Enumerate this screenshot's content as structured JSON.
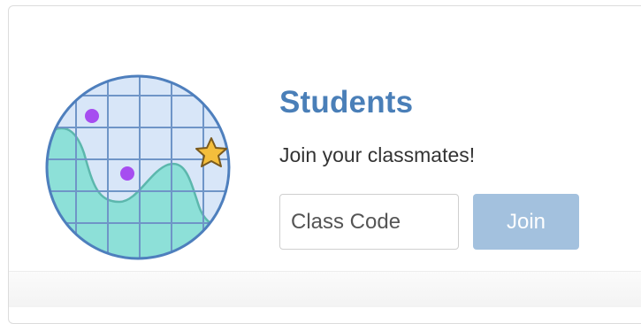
{
  "card": {
    "title": "Students",
    "subtitle": "Join your classmates!",
    "class_code": {
      "value": "",
      "placeholder": "Class Code"
    },
    "join_label": "Join"
  },
  "colors": {
    "title": "#4a7fb8",
    "join_button": "#a3c1de",
    "illustration_bg": "#d8e6f8",
    "illustration_grid": "#6f95c7",
    "illustration_wave": "#8de0d8",
    "illustration_dot": "#a64df0",
    "illustration_star": "#f4be3c"
  },
  "icons": {
    "illustration": "graph-chart-illustration"
  }
}
